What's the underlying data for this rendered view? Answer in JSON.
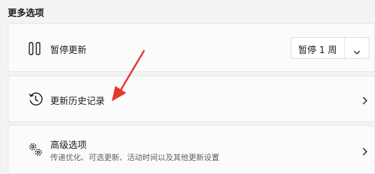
{
  "section": {
    "title": "更多选项"
  },
  "pause": {
    "label": "暂停更新",
    "dropdown_value": "暂停 1 周",
    "icon": "pause-icon"
  },
  "history": {
    "label": "更新历史记录",
    "icon": "history-clock-icon"
  },
  "advanced": {
    "label": "高级选项",
    "description": "传递优化、可选更新、活动时间以及其他更新设置",
    "icon": "gears-icon"
  },
  "annotation": {
    "arrow_color": "#e8372f"
  }
}
